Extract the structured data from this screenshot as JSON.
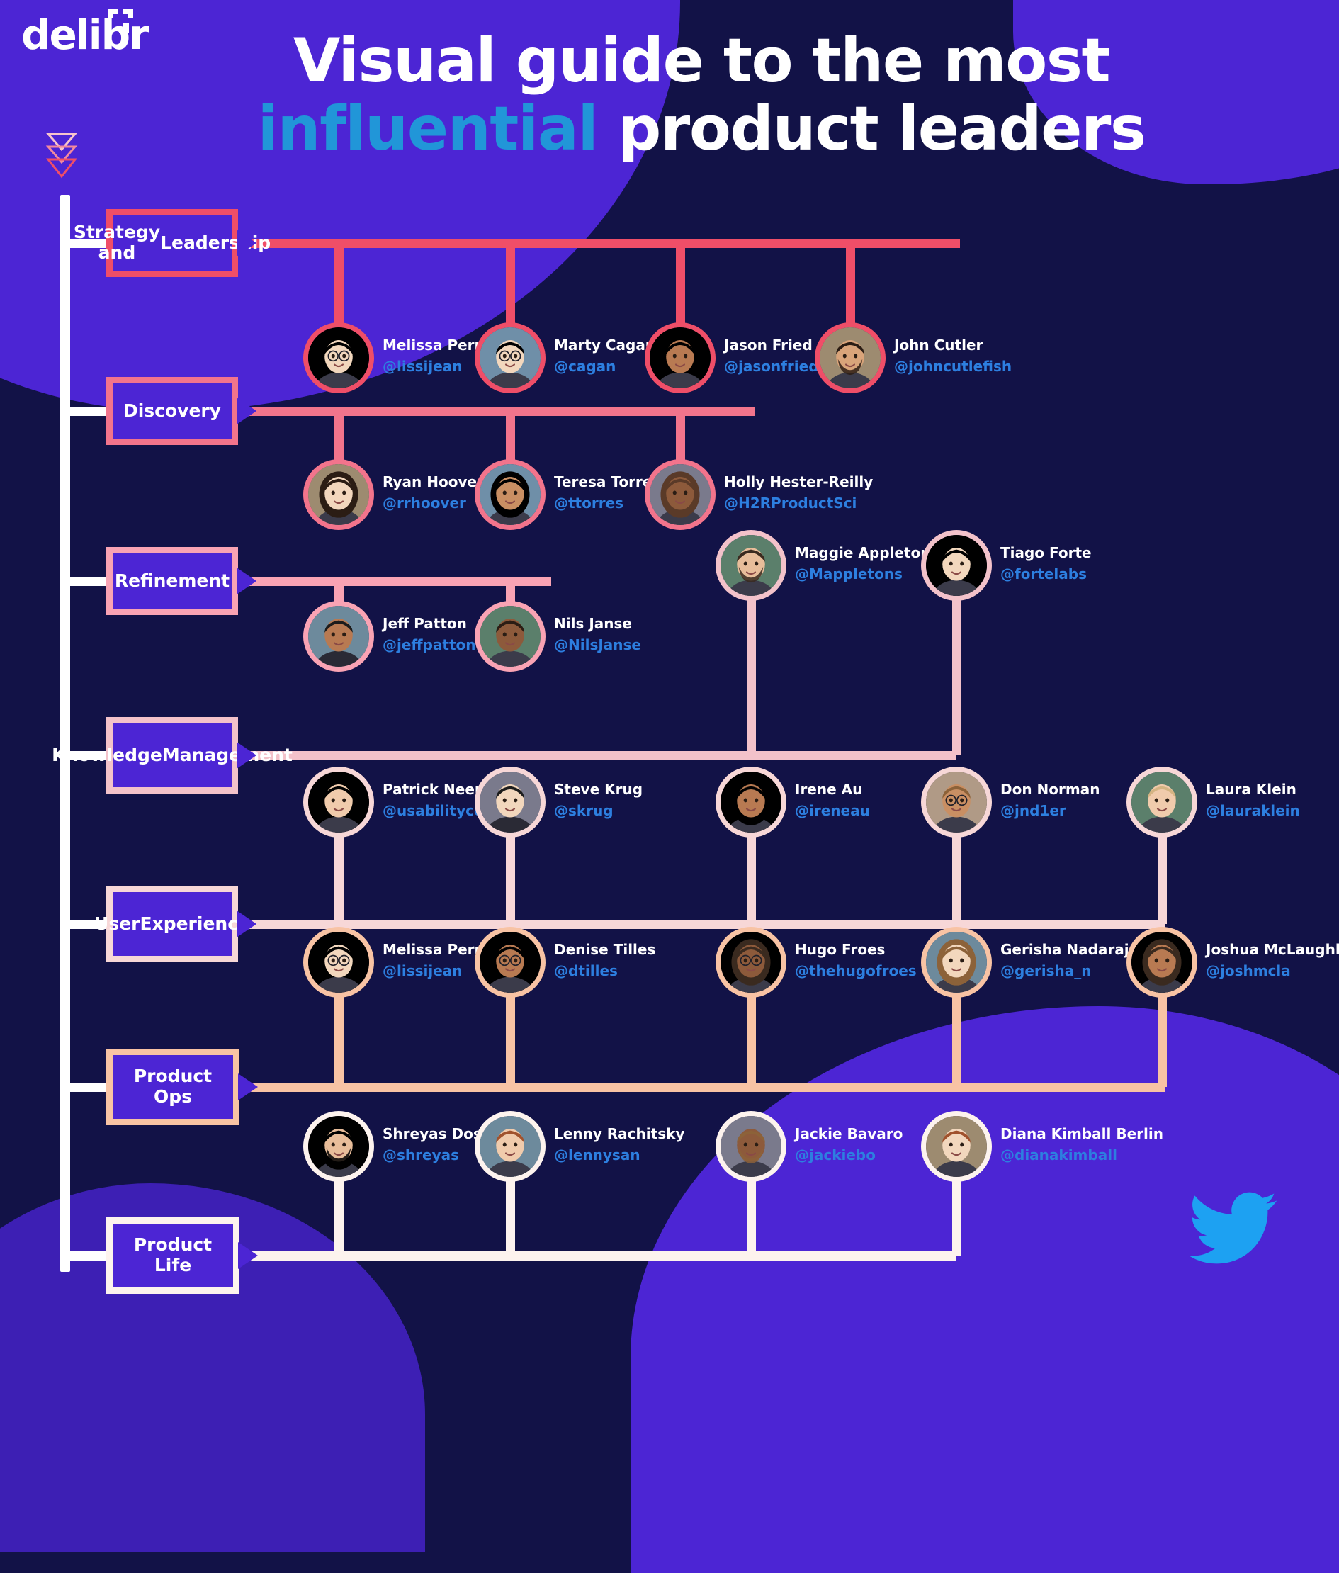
{
  "brand": {
    "logo_text": "delibr",
    "logo_mark_name": "delibr-bracket-mark"
  },
  "title": {
    "line1": "Visual guide to the most",
    "line2_accent": "influential",
    "line2_rest": " product leaders"
  },
  "colors": {
    "background": "#121247",
    "brand_purple": "#4c25d4",
    "accent_blue": "#2196d8",
    "handle_blue": "#2d7fe0",
    "row1": "#ef4e68",
    "row2": "#f2748c",
    "row3": "#f9a3b4",
    "row4": "#f3c2ca",
    "row5": "#f7d7d7",
    "row6": "#f8c3a4",
    "row7": "#fdf3ee"
  },
  "footer": {
    "twitter_icon": "twitter-bird-icon"
  },
  "sections": [
    {
      "id": "strategy-and-leadership",
      "label": "Strategy and\nLeadership",
      "color": "#ef4e68",
      "people": [
        {
          "name": "Melissa Perri",
          "handle": "@lissijean"
        },
        {
          "name": "Marty Cagan",
          "handle": "@cagan"
        },
        {
          "name": "Jason Fried",
          "handle": "@jasonfried"
        },
        {
          "name": "John Cutler",
          "handle": "@johncutlefish"
        }
      ]
    },
    {
      "id": "discovery",
      "label": "Discovery",
      "color": "#f2748c",
      "people": [
        {
          "name": "Ryan Hoover",
          "handle": "@rrhoover"
        },
        {
          "name": "Teresa Torres",
          "handle": "@ttorres"
        },
        {
          "name": "Holly Hester-Reilly",
          "handle": "@H2RProductSci"
        }
      ]
    },
    {
      "id": "refinement",
      "label": "Refinement",
      "color": "#f9a3b4",
      "people": [
        {
          "name": "Jeff Patton",
          "handle": "@jeffpatton"
        },
        {
          "name": "Nils Janse",
          "handle": "@NilsJanse"
        }
      ]
    },
    {
      "id": "knowledge-management",
      "label": "Knowledge\nManagement",
      "color": "#f3c2ca",
      "people": [
        {
          "name": "Maggie Appleton",
          "handle": "@Mappletons"
        },
        {
          "name": "Tiago Forte",
          "handle": "@fortelabs"
        }
      ]
    },
    {
      "id": "user-experience",
      "label": "User\nExperience",
      "color": "#f7d7d7",
      "people": [
        {
          "name": "Patrick Neeman",
          "handle": "@usabilitycounts"
        },
        {
          "name": "Steve Krug",
          "handle": "@skrug"
        },
        {
          "name": "Irene Au",
          "handle": "@ireneau"
        },
        {
          "name": "Don Norman",
          "handle": "@jnd1er"
        },
        {
          "name": "Laura Klein",
          "handle": "@lauraklein"
        }
      ]
    },
    {
      "id": "product-ops",
      "label": "Product Ops",
      "color": "#f8c3a4",
      "people": [
        {
          "name": "Melissa Perri",
          "handle": "@lissijean"
        },
        {
          "name": "Denise Tilles",
          "handle": "@dtilles"
        },
        {
          "name": "Hugo Froes",
          "handle": "@thehugofroes"
        },
        {
          "name": "Gerisha Nadaraju",
          "handle": "@gerisha_n"
        },
        {
          "name": "Joshua McLaughlin",
          "handle": "@joshmcla"
        }
      ]
    },
    {
      "id": "product-life",
      "label": "Product Life",
      "color": "#fdf3ee",
      "people": [
        {
          "name": "Shreyas Doshi",
          "handle": "@shreyas"
        },
        {
          "name": "Lenny Rachitsky",
          "handle": "@lennysan"
        },
        {
          "name": "Jackie Bavaro",
          "handle": "@jackiebo"
        },
        {
          "name": "Diana Kimball Berlin",
          "handle": "@dianakimball"
        }
      ]
    }
  ]
}
